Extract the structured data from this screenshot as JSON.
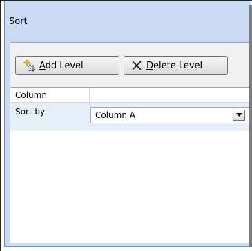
{
  "dialog": {
    "title": "Sort"
  },
  "toolbar": {
    "add_level": {
      "prefix": "A",
      "rest": "dd Level",
      "icon": "add-level-icon"
    },
    "delete_level": {
      "prefix": "D",
      "rest": "elete Level",
      "icon": "delete-x-icon"
    }
  },
  "grid": {
    "column_header": "Column",
    "row": {
      "label": "Sort by",
      "selected_value": "Column A",
      "dropdown_icon": "chevron-down-icon"
    }
  }
}
